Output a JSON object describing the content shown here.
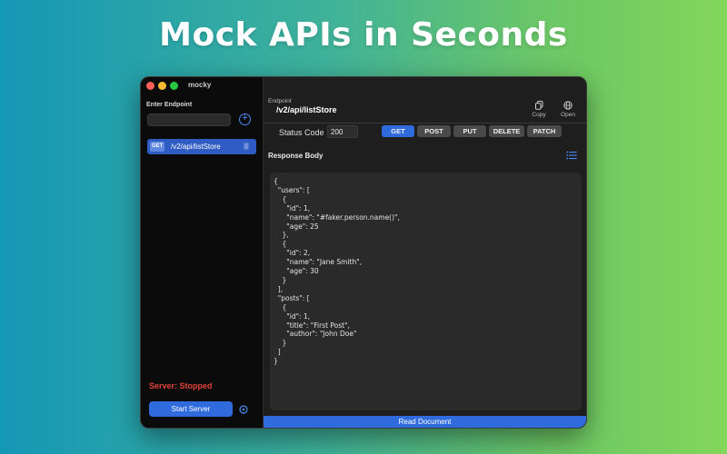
{
  "headline": "Mock APIs in Seconds",
  "window": {
    "title": "mocky"
  },
  "sidebar": {
    "label": "Enter Endpoint",
    "input_value": "",
    "input_placeholder": "",
    "endpoints": [
      {
        "method": "GET",
        "path": "/v2/api/listStore",
        "selected": true
      }
    ],
    "server_status": "Server: Stopped",
    "start_button": "Start Server"
  },
  "main": {
    "endpoint_label": "Endpoint",
    "endpoint_value": "/v2/api/listStore",
    "tools": {
      "copy": "Copy",
      "open": "Open"
    },
    "status_label": "Status Code",
    "status_value": "200",
    "methods": [
      "GET",
      "POST",
      "PUT",
      "DELETE",
      "PATCH"
    ],
    "active_method": "GET",
    "response_body_label": "Response Body",
    "response_body": "{\n  \"users\": [\n    {\n      \"id\": 1,\n      \"name\": \"#faker.person.name()\",\n      \"age\": 25\n    },\n    {\n      \"id\": 2,\n      \"name\": \"Jane Smith\",\n      \"age\": 30\n    }\n  ],\n  \"posts\": [\n    {\n      \"id\": 1,\n      \"title\": \"First Post\",\n      \"author\": \"John Doe\"\n    }\n  ]\n}",
    "read_document": "Read Document"
  },
  "colors": {
    "accent": "#2f6bdd",
    "status_stopped": "#e0433a",
    "window_bg": "#1e1e1e",
    "sidebar_bg": "#0b0b0b"
  }
}
